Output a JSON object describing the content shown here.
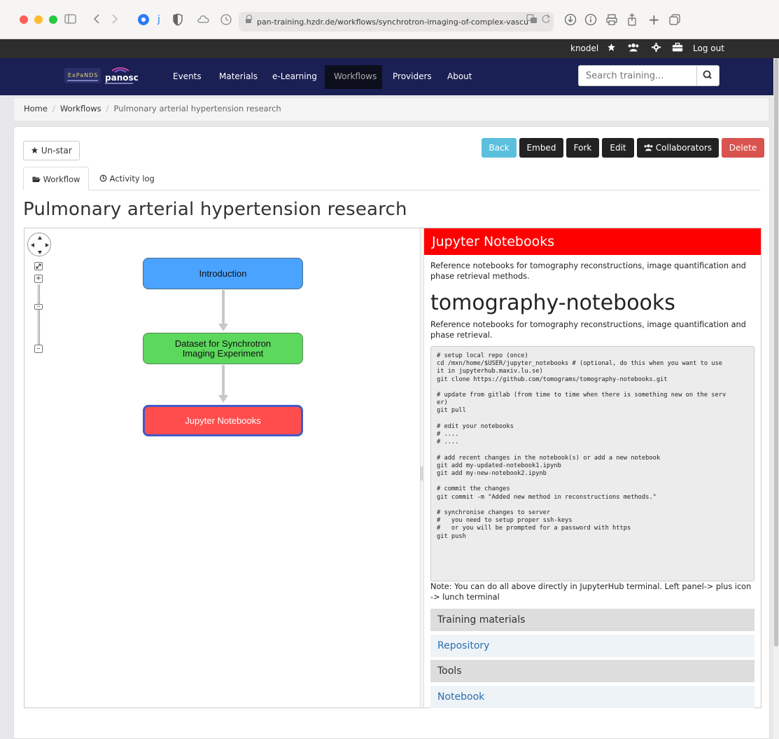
{
  "browser": {
    "url": "pan-training.hzdr.de/workflows/synchrotron-imaging-of-complex-vascu"
  },
  "userbar": {
    "username": "knodel",
    "logout": "Log out"
  },
  "nav": {
    "links": [
      "Events",
      "Materials",
      "e-Learning",
      "Workflows",
      "Providers",
      "About"
    ],
    "search_placeholder": "Search training..."
  },
  "breadcrumb": {
    "home": "Home",
    "workflows": "Workflows",
    "current": "Pulmonary arterial hypertension research"
  },
  "actions": {
    "unstar": "Un-star",
    "back": "Back",
    "embed": "Embed",
    "fork": "Fork",
    "edit": "Edit",
    "collaborators": "Collaborators",
    "delete": "Delete"
  },
  "tabs": {
    "workflow": "Workflow",
    "activity": "Activity log"
  },
  "page_title": "Pulmonary arterial hypertension research",
  "workflow": {
    "nodes": [
      {
        "label": "Introduction",
        "color": "#4aa3ff"
      },
      {
        "label": "Dataset for Synchrotron Imaging Experiment",
        "color": "#5cd85c"
      },
      {
        "label": "Jupyter Notebooks",
        "color": "#ff4d4d"
      }
    ]
  },
  "side_panel": {
    "header": "Jupyter Notebooks",
    "header_color": "#ff0000",
    "intro": "Reference notebooks for tomography reconstructions, image quantification and phase retrieval methods.",
    "nb_title": "tomography-notebooks",
    "nb_desc": "Reference notebooks for tomography reconstructions, image quantification and phase retrieval.",
    "code": "# setup local repo (once)\ncd /mxn/home/$USER/jupyter_notebooks # (optional, do this when you want to use\nit in jupyterhub.maxiv.lu.se)\ngit clone https://github.com/tomograms/tomography-notebooks.git\n\n# update from gitlab (from time to time when there is something new on the serv\ner)\ngit pull\n\n# edit your notebooks\n# ....\n# ....\n\n# add recent changes in the notebook(s) or add a new notebook\ngit add my-updated-notebook1.ipynb\ngit add my-new-notebook2.ipynb\n\n# commit the changes\ngit commit -m \"Added new method in reconstructions methods.\"\n\n# synchronise changes to server\n#   you need to setup proper ssh-keys\n#   or you will be prompted for a password with https\ngit push",
    "note": "Note: You can do all above directly in JupyterHub terminal. Left panel-> plus icon -> lunch terminal",
    "training_materials_header": "Training materials",
    "training_link": "Repository",
    "tools_header": "Tools",
    "tools_link": "Notebook"
  }
}
